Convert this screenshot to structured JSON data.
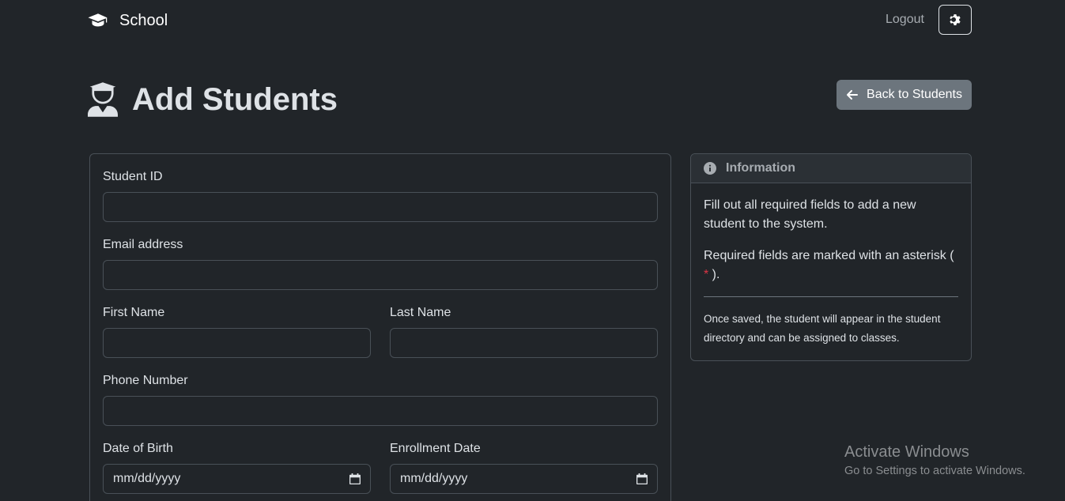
{
  "navbar": {
    "brand_label": "School",
    "brand_icon": "graduation-cap-icon",
    "logout_label": "Logout",
    "theme_icon": "gear-icon"
  },
  "header": {
    "title": "Add Students",
    "title_icon": "user-graduate-icon",
    "back_label": "Back to Students",
    "back_icon": "arrow-left-icon"
  },
  "form": {
    "student_id": {
      "label": "Student ID",
      "value": ""
    },
    "email": {
      "label": "Email address",
      "value": ""
    },
    "first_name": {
      "label": "First Name",
      "value": ""
    },
    "last_name": {
      "label": "Last Name",
      "value": ""
    },
    "phone": {
      "label": "Phone Number",
      "value": ""
    },
    "dob": {
      "label": "Date of Birth",
      "value": "mm/dd/yyyy"
    },
    "enrollment": {
      "label": "Enrollment Date",
      "value": "mm/dd/yyyy"
    }
  },
  "info": {
    "title": "Information",
    "icon": "info-circle-icon",
    "paragraph1": "Fill out all required fields to add a new student to the system.",
    "paragraph2_pre": "Required fields are marked with an asterisk ( ",
    "asterisk": "*",
    "paragraph2_post": " ).",
    "note": "Once saved, the student will appear in the student directory and can be assigned to classes."
  },
  "watermark": {
    "title": "Activate Windows",
    "subtitle": "Go to Settings to activate Windows."
  },
  "colors": {
    "background": "#212529",
    "border": "#495057",
    "secondary_button": "#6c757d",
    "danger": "#dc3545"
  }
}
